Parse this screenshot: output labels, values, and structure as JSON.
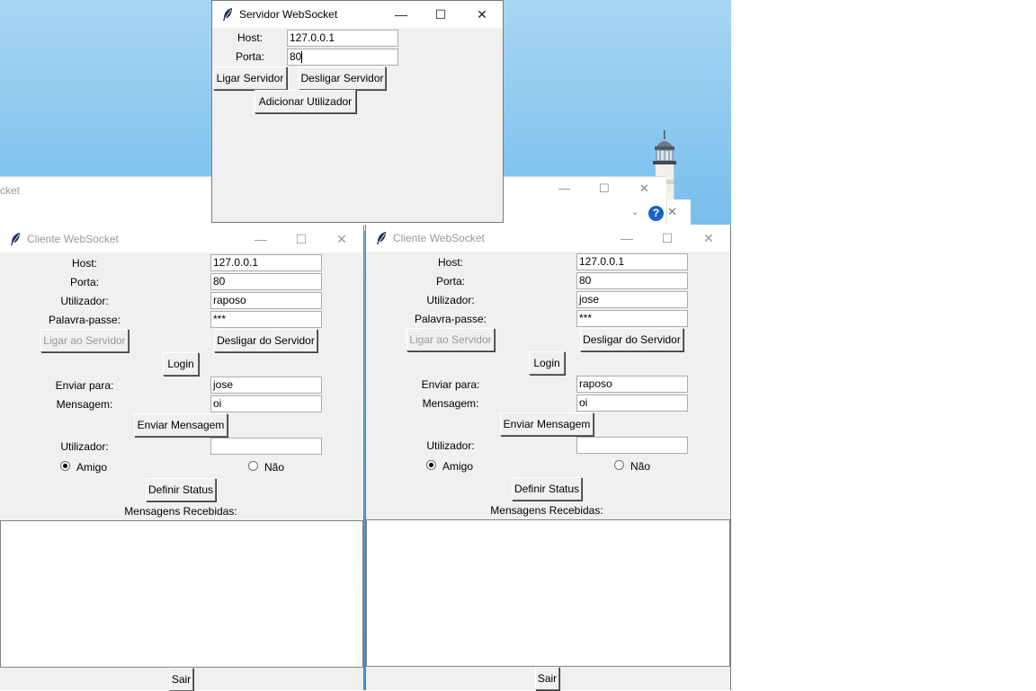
{
  "server": {
    "title": "Servidor WebSocket",
    "host_label": "Host:",
    "host_value": "127.0.0.1",
    "port_label": "Porta:",
    "port_value": "80",
    "start_button": "Ligar Servidor",
    "stop_button": "Desligar Servidor",
    "add_user_button": "Adicionar Utilizador"
  },
  "background_window": {
    "title_fragment": "cket"
  },
  "client1": {
    "title": "Cliente WebSocket",
    "host_label": "Host:",
    "host_value": "127.0.0.1",
    "port_label": "Porta:",
    "port_value": "80",
    "user_label": "Utilizador:",
    "user_value": "raposo",
    "password_label": "Palavra-passe:",
    "password_value": "***",
    "connect_button": "Ligar ao Servidor",
    "disconnect_button": "Desligar do Servidor",
    "login_button": "Login",
    "send_to_label": "Enviar para:",
    "send_to_value": "jose",
    "message_label": "Mensagem:",
    "message_value": "oi",
    "send_button": "Enviar Mensagem",
    "status_user_label": "Utilizador:",
    "status_user_value": "",
    "radio_friend": "Amigo",
    "radio_no": "Não",
    "set_status_button": "Definir Status",
    "received_label": "Mensagens Recebidas:",
    "exit_button": "Sair"
  },
  "client2": {
    "title": "Cliente WebSocket",
    "host_label": "Host:",
    "host_value": "127.0.0.1",
    "port_label": "Porta:",
    "port_value": "80",
    "user_label": "Utilizador:",
    "user_value": "jose",
    "password_label": "Palavra-passe:",
    "password_value": "***",
    "connect_button": "Ligar ao Servidor",
    "disconnect_button": "Desligar do Servidor",
    "login_button": "Login",
    "send_to_label": "Enviar para:",
    "send_to_value": "raposo",
    "message_label": "Mensagem:",
    "message_value": "oi",
    "send_button": "Enviar Mensagem",
    "status_user_label": "Utilizador:",
    "status_user_value": "",
    "radio_friend": "Amigo",
    "radio_no": "Não",
    "set_status_button": "Definir Status",
    "received_label": "Mensagens Recebidas:",
    "exit_button": "Sair"
  },
  "colors": {
    "window_bg": "#f0f0f0",
    "help_button": "#1a63c6"
  },
  "icons": [
    "feather-icon",
    "minimize-icon",
    "maximize-icon",
    "close-icon",
    "help-icon",
    "chevron-down-icon"
  ]
}
